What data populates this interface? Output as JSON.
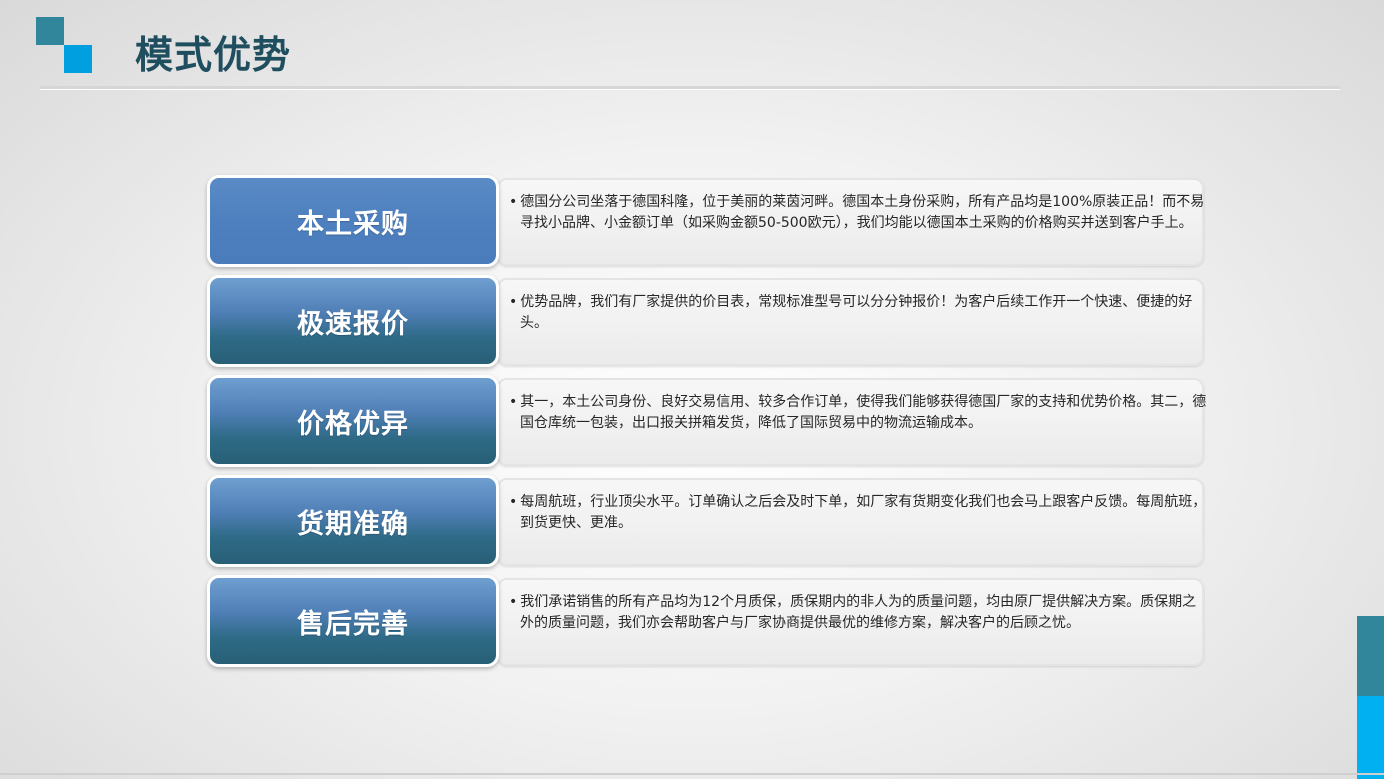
{
  "slide": {
    "title": "模式优势",
    "colors": {
      "title": "#1f4e5f",
      "accent_teal": "#31869b",
      "accent_blue": "#00a0e0",
      "label_blue": "#4f81bd",
      "label_dark": "#285f76"
    }
  },
  "rows": [
    {
      "label": "本土采购",
      "text": "德国分公司坐落于德国科隆，位于美丽的莱茵河畔。德国本土身份采购，所有产品均是100%原装正品！而不易寻找小品牌、小金额订单（如采购金额50-500欧元），我们均能以德国本土采购的价格购买并送到客户手上。"
    },
    {
      "label": "极速报价",
      "text": "优势品牌，我们有厂家提供的价目表，常规标准型号可以分分钟报价！为客户后续工作开一个快速、便捷的好头。"
    },
    {
      "label": "价格优异",
      "text": "其一，本土公司身份、良好交易信用、较多合作订单，使得我们能够获得德国厂家的支持和优势价格。其二，德国仓库统一包装，出口报关拼箱发货，降低了国际贸易中的物流运输成本。"
    },
    {
      "label": "货期准确",
      "text": "每周航班，行业顶尖水平。订单确认之后会及时下单，如厂家有货期变化我们也会马上跟客户反馈。每周航班，到货更快、更准。"
    },
    {
      "label": "售后完善",
      "text": "我们承诺销售的所有产品均为12个月质保，质保期内的非人为的质量问题，均由原厂提供解决方案。质保期之外的质量问题，我们亦会帮助客户与厂家协商提供最优的维修方案，解决客户的后顾之忧。"
    }
  ],
  "bullet": "•"
}
